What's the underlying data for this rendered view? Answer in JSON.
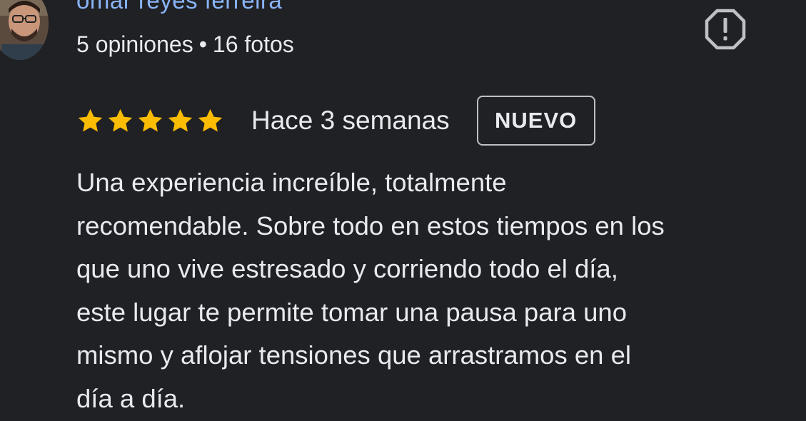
{
  "reviewer": {
    "name": "omar reyes ferreira",
    "reviews_count": "5 opiniones",
    "separator": "•",
    "photos_count": "16 fotos"
  },
  "review": {
    "rating": 5,
    "max_rating": 5,
    "time": "Hace 3 semanas",
    "badge": "NUEVO",
    "text_lines": [
      "Una experiencia increíble, totalmente",
      "recomendable. Sobre todo en estos tiempos en los",
      "que uno vive estresado y corriendo todo el día,",
      "este lugar te permite tomar una pausa para uno",
      "mismo y aflojar tensiones que arrastramos en el",
      "día a día."
    ]
  },
  "icons": {
    "avatar": "avatar-photo",
    "report": "report-icon",
    "star": "star-icon"
  },
  "colors": {
    "background": "#202124",
    "name": "#8ab4f8",
    "text": "#e8eaed",
    "star": "#fbbc04",
    "badge_border": "#bdc1c6"
  }
}
